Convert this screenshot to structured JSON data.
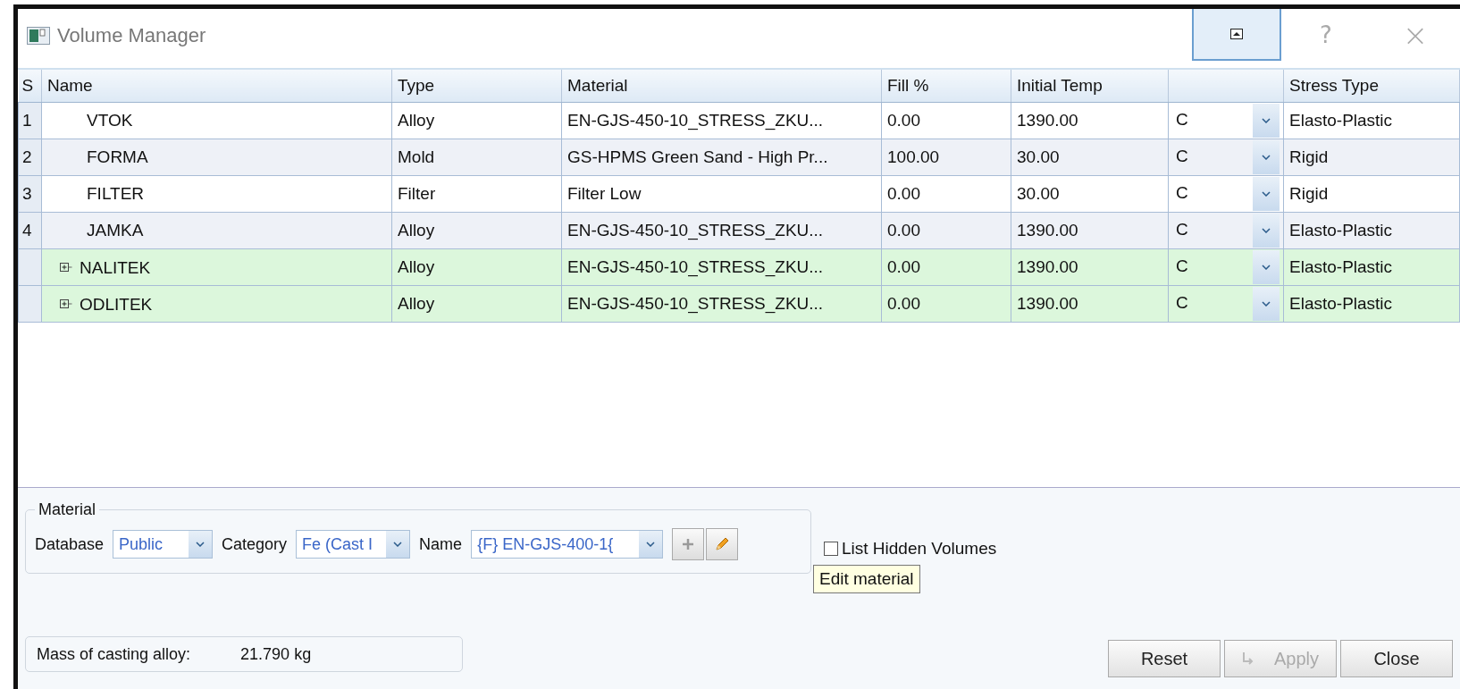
{
  "window": {
    "title": "Volume Manager",
    "help_glyph": "?",
    "close_glyph": "×"
  },
  "table": {
    "columns": [
      "S",
      "Name",
      "Type",
      "Material",
      "Fill %",
      "Initial Temp",
      "",
      "Stress Type"
    ],
    "rows": [
      {
        "kind": "volume",
        "index": "1",
        "name": "VTOK",
        "type": "Alloy",
        "material": "EN-GJS-450-10_STRESS_ZKU...",
        "fill": "0.00",
        "temp": "1390.00",
        "unit": "C",
        "stress": "Elasto-Plastic"
      },
      {
        "kind": "volume",
        "index": "2",
        "name": "FORMA",
        "type": "Mold",
        "material": "GS-HPMS Green Sand - High Pr...",
        "fill": "100.00",
        "temp": "30.00",
        "unit": "C",
        "stress": "Rigid"
      },
      {
        "kind": "volume",
        "index": "3",
        "name": "FILTER",
        "type": "Filter",
        "material": "Filter Low",
        "fill": "0.00",
        "temp": "30.00",
        "unit": "C",
        "stress": "Rigid"
      },
      {
        "kind": "volume",
        "index": "4",
        "name": "JAMKA",
        "type": "Alloy",
        "material": "EN-GJS-450-10_STRESS_ZKU...",
        "fill": "0.00",
        "temp": "1390.00",
        "unit": "C",
        "stress": "Elasto-Plastic"
      },
      {
        "kind": "group",
        "expanded": false,
        "name": "NALITEK",
        "type": "Alloy",
        "material": "EN-GJS-450-10_STRESS_ZKU...",
        "fill": "0.00",
        "temp": "1390.00",
        "unit": "C",
        "stress": "Elasto-Plastic"
      },
      {
        "kind": "group",
        "expanded": false,
        "name": "ODLITEK",
        "type": "Alloy",
        "material": "EN-GJS-450-10_STRESS_ZKU...",
        "fill": "0.00",
        "temp": "1390.00",
        "unit": "C",
        "stress": "Elasto-Plastic"
      }
    ]
  },
  "material": {
    "legend": "Material",
    "database_label": "Database",
    "database": "Public",
    "category_label": "Category",
    "category": "Fe (Cast I",
    "name_label": "Name",
    "name": "{F} EN-GJS-400-1{"
  },
  "list_hidden": {
    "label": "List Hidden Volumes",
    "checked": false
  },
  "tooltip": "Edit material",
  "mass": {
    "label": "Mass of casting alloy:",
    "value": "21.790 kg"
  },
  "buttons": [
    {
      "label": "Reset",
      "disabled": false
    },
    {
      "label": "Apply",
      "disabled": true,
      "icon": true
    },
    {
      "label": "Close",
      "disabled": false
    }
  ]
}
